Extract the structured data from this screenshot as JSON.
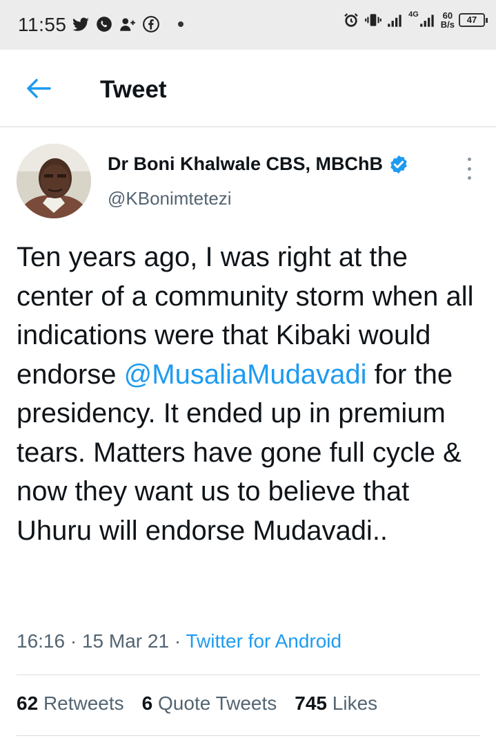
{
  "status_bar": {
    "time": "11:55",
    "network_type": "4G",
    "speed_value": "60",
    "speed_unit": "B/s",
    "battery": "47",
    "icons_left": [
      "twitter-icon",
      "whatsapp-icon",
      "add-user-icon",
      "facebook-icon",
      "dot-icon"
    ],
    "icons_right": [
      "alarm-icon",
      "vibrate-icon",
      "signal-icon",
      "signal-4g-icon",
      "battery-icon"
    ]
  },
  "header": {
    "title": "Tweet",
    "back_icon": "arrow-left-icon"
  },
  "tweet": {
    "author_name": "Dr Boni Khalwale CBS, MBChB",
    "handle": "@KBonimtetezi",
    "verified": true,
    "text_part1": "Ten years ago, I was right at the center of a community storm when all indications were that Kibaki would endorse ",
    "mention": "@MusaliaMudavadi",
    "text_part2": " for the presidency. It ended up in premium tears. Matters have gone full cycle & now they want us to believe that Uhuru will endorse Mudavadi..",
    "time": "16:16",
    "separator": " · ",
    "date": "15 Mar 21",
    "source": "Twitter for Android"
  },
  "stats": {
    "retweets_count": "62",
    "retweets_label": "Retweets",
    "quotes_count": "6",
    "quotes_label": "Quote Tweets",
    "likes_count": "745",
    "likes_label": "Likes"
  },
  "colors": {
    "accent": "#1d9bf0",
    "text": "#0f1419",
    "secondary": "#536471",
    "status_bar_bg": "#ececec"
  }
}
